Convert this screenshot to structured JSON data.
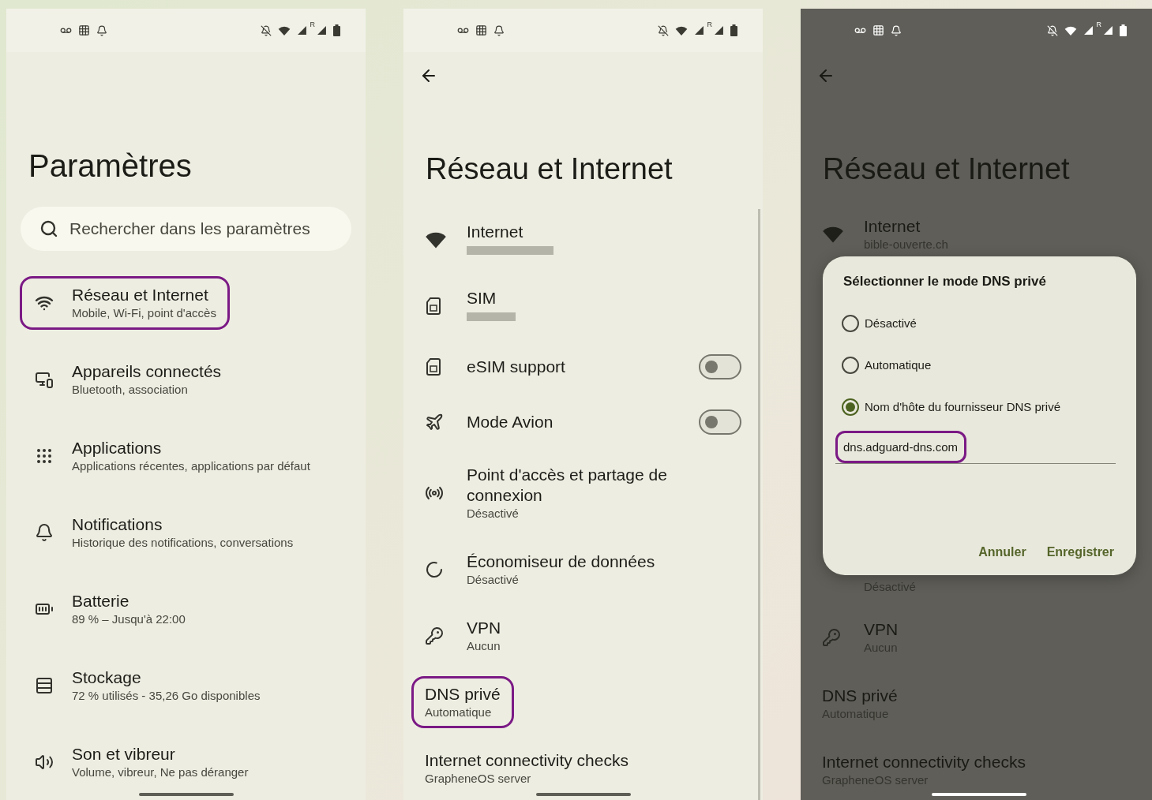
{
  "screens": [
    {
      "kind": "home",
      "status_bar": {
        "roaming": "R"
      },
      "title": "Paramètres",
      "search": {
        "placeholder": "Rechercher dans les paramètres"
      },
      "items": [
        {
          "title": "Réseau et Internet",
          "subtitle": "Mobile, Wi-Fi, point d'accès",
          "highlighted": true
        },
        {
          "title": "Appareils connectés",
          "subtitle": "Bluetooth, association",
          "highlighted": false
        },
        {
          "title": "Applications",
          "subtitle": "Applications récentes, applications par défaut",
          "highlighted": false
        },
        {
          "title": "Notifications",
          "subtitle": "Historique des notifications, conversations",
          "highlighted": false
        },
        {
          "title": "Batterie",
          "subtitle": "89 % – Jusqu'à 22:00",
          "highlighted": false
        },
        {
          "title": "Stockage",
          "subtitle": "72 % utilisés - 35,26 Go disponibles",
          "highlighted": false
        },
        {
          "title": "Son et vibreur",
          "subtitle": "Volume, vibreur, Ne pas déranger",
          "highlighted": false
        }
      ]
    },
    {
      "kind": "list",
      "status_bar": {
        "roaming": "R"
      },
      "title": "Réseau et Internet",
      "items": [
        {
          "kind": "link",
          "title": "Internet",
          "subtitle_redacted": true,
          "highlighted": false
        },
        {
          "kind": "link",
          "title": "SIM",
          "subtitle_redacted": true,
          "highlighted": false
        },
        {
          "kind": "toggle",
          "title": "eSIM support",
          "on": false,
          "highlighted": false
        },
        {
          "kind": "toggle",
          "title": "Mode Avion",
          "on": false,
          "highlighted": false
        },
        {
          "kind": "link",
          "title": "Point d'accès et partage de connexion",
          "subtitle": "Désactivé",
          "highlighted": false
        },
        {
          "kind": "link",
          "title": "Économiseur de données",
          "subtitle": "Désactivé",
          "highlighted": false
        },
        {
          "kind": "link",
          "title": "VPN",
          "subtitle": "Aucun",
          "highlighted": false
        },
        {
          "kind": "link",
          "title": "DNS privé",
          "subtitle": "Automatique",
          "highlighted": true
        },
        {
          "kind": "link",
          "title": "Internet connectivity checks",
          "subtitle": "GrapheneOS server",
          "highlighted": false
        }
      ]
    },
    {
      "kind": "dialog",
      "status_bar": {
        "roaming": "R"
      },
      "title": "Réseau et Internet",
      "items_above": [
        {
          "title": "Internet",
          "subtitle": "bible-ouverte.ch"
        }
      ],
      "dialog": {
        "title": "Sélectionner le mode DNS privé",
        "options": [
          {
            "label": "Désactivé",
            "selected": false
          },
          {
            "label": "Automatique",
            "selected": false
          },
          {
            "label": "Nom d'hôte du fournisseur DNS privé",
            "selected": true
          }
        ],
        "field": {
          "value": "dns.adguard-dns.com",
          "highlighted": true
        },
        "buttons": [
          "Annuler",
          "Enregistrer"
        ]
      },
      "items_below": [
        {
          "subtitle": "Désactivé"
        },
        {
          "title": "VPN",
          "subtitle": "Aucun"
        },
        {
          "title": "DNS privé",
          "subtitle": "Automatique"
        },
        {
          "title": "Internet connectivity checks",
          "subtitle": "GrapheneOS server"
        }
      ]
    }
  ]
}
